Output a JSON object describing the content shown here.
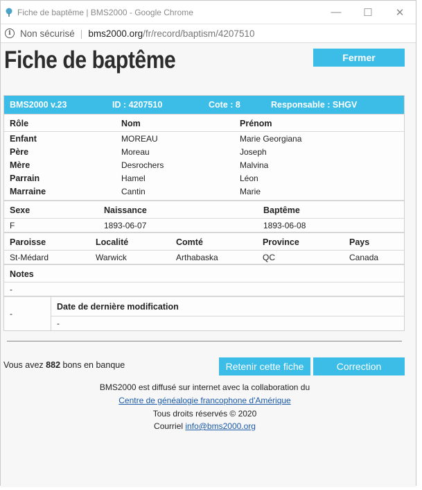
{
  "browser": {
    "tab_title": "Fiche de baptême | BMS2000 - Google Chrome",
    "not_secure": "Non sécurisé",
    "url_host": "bms2000.org",
    "url_path": "/fr/record/baptism/4207510",
    "controls": {
      "minimize": "—",
      "maximize": "☐",
      "close": "✕"
    }
  },
  "page": {
    "title": "Fiche de baptême",
    "close_label": "Fermer"
  },
  "record": {
    "header": {
      "version": "BMS2000 v.23",
      "id": "ID : 4207510",
      "cote": "Cote : 8",
      "responsable": "Responsable : SHGV"
    },
    "people": {
      "columns": [
        "Rôle",
        "Nom",
        "Prénom"
      ],
      "rows": [
        {
          "role": "Enfant",
          "nom": "MOREAU",
          "prenom": "Marie Georgiana"
        },
        {
          "role": "Père",
          "nom": "Moreau",
          "prenom": "Joseph"
        },
        {
          "role": "Mère",
          "nom": "Desrochers",
          "prenom": "Malvina"
        },
        {
          "role": "Parrain",
          "nom": "Hamel",
          "prenom": "Léon"
        },
        {
          "role": "Marraine",
          "nom": "Cantin",
          "prenom": "Marie"
        }
      ]
    },
    "dates": {
      "columns": [
        "Sexe",
        "Naissance",
        "Baptême"
      ],
      "values": [
        "F",
        "1893-06-07",
        "1893-06-08"
      ]
    },
    "location": {
      "columns": [
        "Paroisse",
        "Localité",
        "Comté",
        "Province",
        "Pays"
      ],
      "values": [
        "St-Médard",
        "Warwick",
        "Arthabaska",
        "QC",
        "Canada"
      ]
    },
    "notes": {
      "label": "Notes",
      "value": "-"
    },
    "last_mod": {
      "left_value": "-",
      "label": "Date de dernière modification",
      "value": "-"
    }
  },
  "bank": {
    "prefix": "Vous avez",
    "count": "882",
    "suffix": "bons en banque"
  },
  "actions": {
    "retain_label": "Retenir cette fiche",
    "correction_label": "Correction"
  },
  "footer": {
    "line1": "BMS2000 est diffusé sur internet avec la collaboration du",
    "link1": "Centre de généalogie francophone d'Amérique",
    "line3": "Tous droits réservés © 2020",
    "email_prefix": "Courriel",
    "email": "info@bms2000.org"
  },
  "colors": {
    "accent": "#3bbde8",
    "link": "#1a5aa8"
  }
}
